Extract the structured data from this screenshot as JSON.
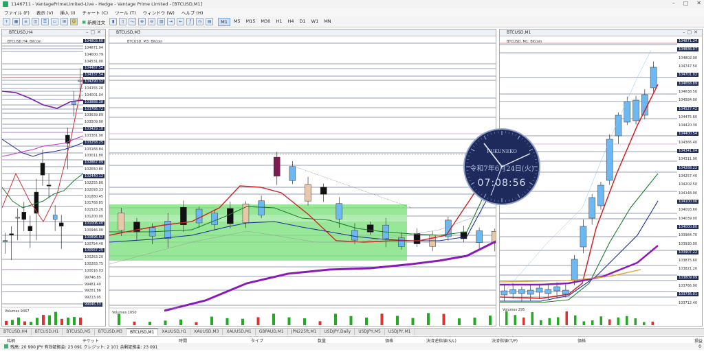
{
  "titlebar": {
    "title": "1146711 - VantagePrimeLimited-Live - Hedge - Vantage Prime Limited - [BTCUSD,M1]"
  },
  "menu": [
    "ファイル (F)",
    "表示 (V)",
    "挿入 (I)",
    "チャート (C)",
    "ツール (T)",
    "ウィンドウ (W)",
    "ヘルプ (H)"
  ],
  "toolbar": {
    "new_order": "新規注文",
    "timeframes": [
      "M1",
      "M5",
      "M15",
      "M30",
      "H1",
      "H4",
      "D1",
      "W1",
      "MN"
    ],
    "active_tf": "M1"
  },
  "charts": {
    "left": {
      "title": "BTCUSD,H4",
      "subtitle": "BTCUSD,H4: Bitcoin",
      "volumes": "Volumes 9467",
      "vol_scale": "59830",
      "yticks": [
        "104803.60",
        "104671.94",
        "104600.79",
        "104531.00",
        "104487.54",
        "104337.54",
        "104290.32",
        "104155.20",
        "104001.04",
        "103888.38",
        "103786.72",
        "103639.89",
        "103509.00",
        "103429.18",
        "103381.90",
        "103258.25",
        "103168.84",
        "103011.80",
        "102867.09",
        "102650.80",
        "102440.12",
        "102255.80",
        "102093.33",
        "101880.45",
        "101768.85",
        "101523.26",
        "101200.00",
        "101006.40",
        "100946.00",
        "100896.63",
        "100754.40",
        "100567.25",
        "100263.20",
        "100283.75",
        "100016.03",
        "99746.85",
        "99481.40",
        "99281.86",
        "99213.95",
        "99046.53"
      ],
      "xticks": [
        "23 Jun 2025",
        "23 Jun 08:00",
        "23 Jun 16:00",
        "24 Jun 00:00"
      ]
    },
    "mid": {
      "title": "BTCUSD,M3",
      "subtitle": "BTCUSD, M3: Bitcoin",
      "volumes": "Volumes 1050",
      "xticks": [
        "23 Jun 2025",
        "23 Jun 23:51",
        "23 Jun 23:57",
        "24 Jun 00:03",
        "24 Jun 00:09",
        "24 Jun 00:15",
        "24 Jun 00:21",
        "24 Jun 00:27",
        "24 Jun 00:33",
        "24 Jun 00:39",
        "24 Jun 00:45",
        "24 Jun 00:51",
        "24 Jun 00:57",
        "24 Jun 01:03"
      ]
    },
    "right": {
      "title": "BTCUSD,M1",
      "subtitle": "BTCUSD, M1: Bitcoin",
      "volumes": "Volumes 295",
      "vol_scale": "521",
      "yticks": [
        "104871.34",
        "104836.07",
        "104802.90",
        "104747.50",
        "104701.02",
        "104658.89",
        "104638.56",
        "104584.00",
        "104527.42",
        "104475.60",
        "104420.30",
        "104400.54",
        "104366.40",
        "104341.04",
        "104311.90",
        "104288.22",
        "104257.40",
        "104202.50",
        "104148.00",
        "104100.06",
        "104093.60",
        "104039.00",
        "104000.80",
        "103984.70",
        "103930.00",
        "103907.22",
        "103875.60",
        "103821.20",
        "103809.09",
        "103766.90",
        "103736.01",
        "103712.40"
      ],
      "xticks": [
        "24 Jun 2025",
        "24 Jun 00:58",
        "24 Jun 01:00",
        "24 Jun 01:02",
        "24 Jun 01:04",
        "24 Jun 01:06",
        "24 Jun 01:08"
      ]
    }
  },
  "clock": {
    "brand": "FUKUNEKO",
    "date": "令和7年6月24日(火)",
    "time": "07:08:56"
  },
  "bottom_tabs": [
    "BTCUSD,H4",
    "BTCUSD,H1",
    "BTCUSD,M5",
    "BTCUSD,M3",
    "BTCUSD,M1",
    "XAUUSD,H1",
    "XAUUSD,M3",
    "XAUUSD,M1",
    "GBPAUD,M1",
    "JPN225ft,M1",
    "USDJPY,Daily",
    "USDJPY,M5",
    "USDJPY,M1"
  ],
  "active_tab": "BTCUSD,M1",
  "terminal": {
    "columns": [
      "銘柄",
      "チケット",
      "時間",
      "タイプ",
      "数量",
      "価格",
      "決済逆指値(S/L)",
      "決済指値(T/P)",
      "価格",
      "損益"
    ],
    "balance_row": "残高: 20 990 JPY  有効証拠金: 23 091  クレジット: 2 101  余剰証拠金: 23 091",
    "balance_value": "0"
  }
}
